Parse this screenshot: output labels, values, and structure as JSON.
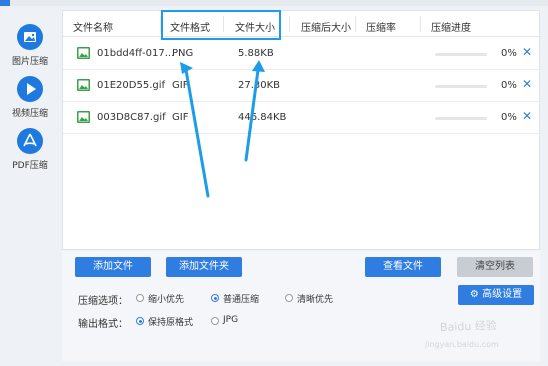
{
  "sidebar": {
    "items": [
      {
        "label": "图片压缩",
        "icon": "image-icon"
      },
      {
        "label": "视频压缩",
        "icon": "play-icon"
      },
      {
        "label": "PDF压缩",
        "icon": "pdf-icon"
      }
    ]
  },
  "table": {
    "columns": [
      "文件名称",
      "文件格式",
      "文件大小",
      "压缩后大小",
      "压缩率",
      "压缩进度"
    ],
    "rows": [
      {
        "name": "01bdd4ff-017...",
        "format": "PNG",
        "size": "5.88KB",
        "progress": "0%",
        "progress_value": 0
      },
      {
        "name": "01E20D55.gif",
        "format": "GIF",
        "size": "27.30KB",
        "progress": "0%",
        "progress_value": 0
      },
      {
        "name": "003D8C87.gif",
        "format": "GIF",
        "size": "446.84KB",
        "progress": "0%",
        "progress_value": 0
      }
    ]
  },
  "buttons": {
    "add_file": "添加文件",
    "add_folder": "添加文件夹",
    "view_file": "查看文件",
    "clear_list": "清空列表",
    "advanced": "高级设置"
  },
  "options": {
    "compress_label": "压缩选项：",
    "compress_choices": [
      "缩小优先",
      "普通压缩",
      "清晰优先"
    ],
    "compress_selected": "普通压缩",
    "format_label": "输出格式：",
    "format_choices": [
      "保持原格式",
      "JPG"
    ],
    "format_selected": "保持原格式"
  },
  "watermark": {
    "main": "Baidu 经验",
    "sub": "jingyan.baidu.com"
  },
  "colors": {
    "accent": "#2f7de1",
    "highlight": "#1e9be9",
    "file_icon": "#3aa148"
  }
}
